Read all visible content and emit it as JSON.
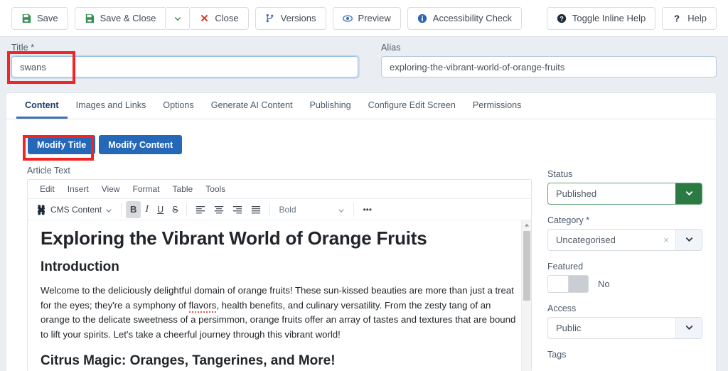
{
  "toolbar": {
    "buttons": [
      {
        "label": "Save",
        "icon": "save-floppy-icon"
      },
      {
        "label": "Save & Close",
        "icon": "save-floppy-icon"
      },
      {
        "label": "Close",
        "icon": "close-x-icon"
      },
      {
        "label": "Versions",
        "icon": "code-branch-icon"
      },
      {
        "label": "Preview",
        "icon": "eye-icon"
      },
      {
        "label": "Accessibility Check",
        "icon": "info-circle-icon"
      }
    ],
    "right_buttons": [
      {
        "label": "Toggle Inline Help",
        "icon": "question-circle-icon"
      },
      {
        "label": "Help",
        "icon": "question-mark-icon"
      }
    ],
    "split_caret": "chevron-down-icon"
  },
  "fields": {
    "title_label": "Title *",
    "title_value": "swans",
    "alias_label": "Alias",
    "alias_value": "exploring-the-vibrant-world-of-orange-fruits"
  },
  "tabs": [
    {
      "label": "Content",
      "active": true
    },
    {
      "label": "Images and Links",
      "active": false
    },
    {
      "label": "Options",
      "active": false
    },
    {
      "label": "Generate AI Content",
      "active": false
    },
    {
      "label": "Publishing",
      "active": false
    },
    {
      "label": "Configure Edit Screen",
      "active": false
    },
    {
      "label": "Permissions",
      "active": false
    }
  ],
  "modify_buttons": [
    {
      "label": "Modify Title"
    },
    {
      "label": "Modify Content"
    }
  ],
  "editor": {
    "label": "Article Text",
    "menus": [
      "Edit",
      "Insert",
      "View",
      "Format",
      "Table",
      "Tools"
    ],
    "cms_content_label": "CMS Content",
    "format_value": "Bold",
    "more_label": "•••",
    "buttons": {
      "bold": "B",
      "italic": "I",
      "underline": "U",
      "strikethrough": "S"
    },
    "content": {
      "h1": "Exploring the Vibrant World of Orange Fruits",
      "h2_intro": "Introduction",
      "paragraph_pre": "Welcome to the deliciously delightful domain of orange fruits! These sun-kissed beauties are more than just a treat for the eyes; they're a symphony of ",
      "paragraph_misspelled": "flavors",
      "paragraph_post": ", health benefits, and culinary versatility. From the zesty tang of an orange to the delicate sweetness of a persimmon, orange fruits offer an array of tastes and textures that are bound to lift your spirits. Let's take a cheerful journey through this vibrant world!",
      "h2_citrus": "Citrus Magic: Oranges, Tangerines, and More!"
    }
  },
  "sidebar": {
    "status_label": "Status",
    "status_value": "Published",
    "category_label": "Category *",
    "category_value": "Uncategorised",
    "category_clear": "×",
    "featured_label": "Featured",
    "featured_value": "No",
    "access_label": "Access",
    "access_value": "Public",
    "tags_label": "Tags"
  },
  "colors": {
    "primary_blue": "#2668b8",
    "status_green": "#2b7a43",
    "annotation_red": "#f52424",
    "save_icon_green": "#3a8f52",
    "close_icon_red": "#d9342b",
    "page_bg": "#eaeef2"
  }
}
